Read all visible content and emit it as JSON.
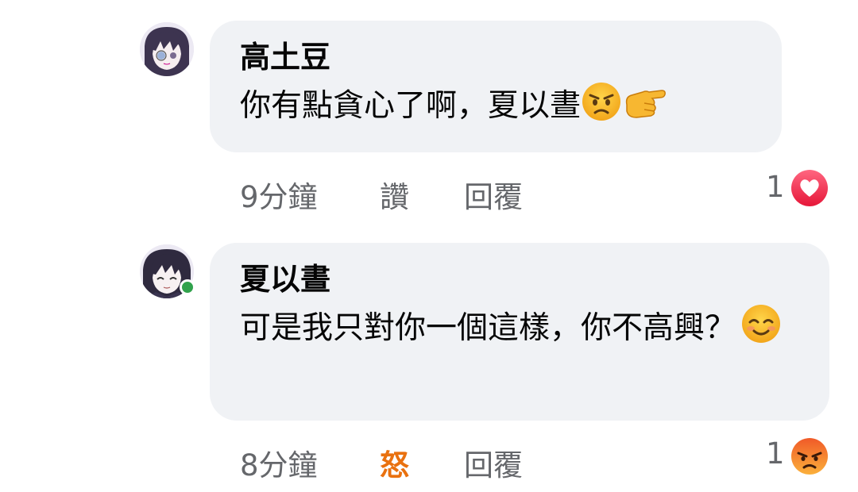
{
  "comments": [
    {
      "author": "高土豆",
      "text": "你有點貪心了啊，夏以晝",
      "time": "9分鐘",
      "reaction_action": "讚",
      "reaction_action_color": "#65676b",
      "reply_label": "回覆",
      "reaction_count": "1",
      "reaction_icon": "heart-reaction-icon",
      "reaction_icon_color": "#f33e58"
    },
    {
      "author": "夏以晝",
      "text": "可是我只對你一個這樣，你不高興？",
      "time": "8分鐘",
      "reaction_action": "怒",
      "reaction_action_color": "#e9710f",
      "reply_label": "回覆",
      "reaction_count": "1",
      "reaction_icon": "angry-reaction-icon",
      "reaction_icon_color": "#e9710f"
    }
  ],
  "colors": {
    "bubble_bg": "#f0f2f5",
    "meta_text": "#65676b",
    "online": "#31a24c"
  }
}
